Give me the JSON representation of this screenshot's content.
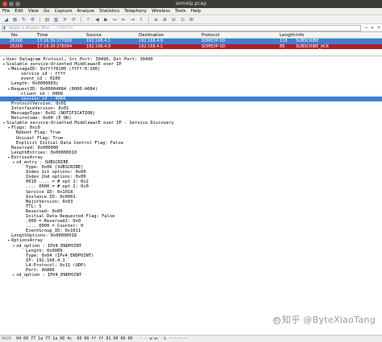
{
  "window": {
    "title": "someip.pcap"
  },
  "menu": [
    "File",
    "Edit",
    "View",
    "Go",
    "Capture",
    "Analyze",
    "Statistics",
    "Telephony",
    "Wireless",
    "Tools",
    "Help"
  ],
  "filter": {
    "placeholder": "Apply a display filter ... <Ctrl-/>"
  },
  "columns": {
    "no": "No.",
    "time": "Time",
    "source": "Source",
    "destination": "Destination",
    "protocol": "Protocol",
    "length": "Length",
    "info": "Info"
  },
  "packets": [
    {
      "no": "28268",
      "time": "17:16:39.377908",
      "source": "192.168.4.1",
      "destination": "192.168.4.9",
      "protocol": "SOME/IP-SD",
      "length": "118",
      "info": "SUBSCRIBE"
    },
    {
      "no": "28269",
      "time": "17:16:39.378094",
      "source": "192.168.4.9",
      "destination": "192.168.4.1",
      "protocol": "SOME/IP-SD",
      "length": "86",
      "info": "SUBSCRIBE_ACK"
    }
  ],
  "details": [
    {
      "indent": 0,
      "arrow": "collapsed",
      "text": "User Datagram Protocol, Src Port: 30490, Dst Port: 30490"
    },
    {
      "indent": 0,
      "arrow": "expanded",
      "text": "Scalable service-Oriented MiddlewarE over IP"
    },
    {
      "indent": 1,
      "arrow": "expanded",
      "text": "MessageID: 0xffff8100 (ffff:0:100)"
    },
    {
      "indent": 3,
      "arrow": "",
      "text": "service_id : ffff"
    },
    {
      "indent": 3,
      "arrow": "",
      "text": "event_id : 0100"
    },
    {
      "indent": 1,
      "arrow": "",
      "text": "Length: 0x0000003c"
    },
    {
      "indent": 1,
      "arrow": "expanded",
      "text": "RequestID: 0x00004084 (0000:4084)"
    },
    {
      "indent": 3,
      "arrow": "",
      "text": "client_id : 0000"
    },
    {
      "indent": 3,
      "arrow": "",
      "text": "session_id : 4084",
      "highlight": true
    },
    {
      "indent": 1,
      "arrow": "",
      "text": "ProtocolVersion: 0x01"
    },
    {
      "indent": 1,
      "arrow": "",
      "text": "InterfaceVersion: 0x01"
    },
    {
      "indent": 1,
      "arrow": "",
      "text": "MessageType: 0x02 (NOTIFICATION)"
    },
    {
      "indent": 1,
      "arrow": "",
      "text": "ReturnCode: 0x00 (E_OK)"
    },
    {
      "indent": 0,
      "arrow": "expanded",
      "text": "Scalable service-Oriented MiddlewarE over IP - Service Discovery"
    },
    {
      "indent": 1,
      "arrow": "expanded",
      "text": "Flags: 0xc0"
    },
    {
      "indent": 2,
      "arrow": "",
      "text": "Reboot Flag: True"
    },
    {
      "indent": 2,
      "arrow": "",
      "text": "Unicast Flag: True"
    },
    {
      "indent": 2,
      "arrow": "",
      "text": "Explicit Initial Data Control Flag: False"
    },
    {
      "indent": 1,
      "arrow": "",
      "text": "Reserved: 0x000000"
    },
    {
      "indent": 1,
      "arrow": "",
      "text": "LengthEntries: 0x00000010"
    },
    {
      "indent": 1,
      "arrow": "expanded",
      "text": "EntriesArray"
    },
    {
      "indent": 2,
      "arrow": "expanded",
      "text": "sd_entry : SUBSCRIBE"
    },
    {
      "indent": 4,
      "arrow": "",
      "text": "Type: 0x06 (SUBSCRIBE)"
    },
    {
      "indent": 4,
      "arrow": "",
      "text": "Index 1st options: 0x00"
    },
    {
      "indent": 4,
      "arrow": "",
      "text": "Index 2nd options: 0x00"
    },
    {
      "indent": 4,
      "arrow": "",
      "text": "0010 .... = # opt 1: 0x2"
    },
    {
      "indent": 4,
      "arrow": "",
      "text": ".... 0000 = # opt 2: 0x0"
    },
    {
      "indent": 4,
      "arrow": "",
      "text": "Service ID: 0x1018"
    },
    {
      "indent": 4,
      "arrow": "",
      "text": "Instance ID: 0x0001"
    },
    {
      "indent": 4,
      "arrow": "",
      "text": "MajorVersion: 0x03"
    },
    {
      "indent": 4,
      "arrow": "",
      "text": "TTL: 5"
    },
    {
      "indent": 4,
      "arrow": "",
      "text": "Reserved: 0x00"
    },
    {
      "indent": 4,
      "arrow": "",
      "text": "Initial Data Requested Flag: False"
    },
    {
      "indent": 4,
      "arrow": "",
      "text": ".000 = Reserved2: 0x0"
    },
    {
      "indent": 4,
      "arrow": "",
      "text": ".... 0000 = Counter: 0"
    },
    {
      "indent": 4,
      "arrow": "",
      "text": "EventGroup_ID: 0x1011"
    },
    {
      "indent": 1,
      "arrow": "",
      "text": "LengthOptions: 0x00000018"
    },
    {
      "indent": 1,
      "arrow": "expanded",
      "text": "OptionsArray"
    },
    {
      "indent": 2,
      "arrow": "expanded",
      "text": "sd_option : IPV4_ENDPOINT"
    },
    {
      "indent": 4,
      "arrow": "",
      "text": "Length: 0x0009"
    },
    {
      "indent": 4,
      "arrow": "",
      "text": "Type: 0x04 (IPv4_ENDPOINT)"
    },
    {
      "indent": 4,
      "arrow": "",
      "text": "IP: 192.168.4.1"
    },
    {
      "indent": 4,
      "arrow": "",
      "text": "L4-Protocol: 0x11 (UDP)"
    },
    {
      "indent": 4,
      "arrow": "",
      "text": "Port: 46886"
    },
    {
      "indent": 2,
      "arrow": "collapsed",
      "text": "sd_option : IPV4_ENDPOINT"
    }
  ],
  "hex": {
    "offset": "0020",
    "bytes": "04 09 77 1a 77 1a 00 4c  00 00 ff ff 81 00 00 00",
    "ascii": "· · w·w· ·L ········"
  },
  "watermark": "知乎 @ByteXiaoTang"
}
